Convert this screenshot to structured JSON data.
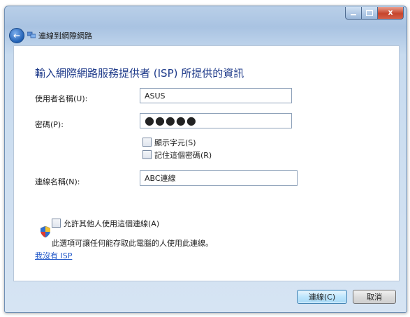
{
  "window": {
    "close_glyph": "x"
  },
  "nav": {
    "back_glyph": "←",
    "title": "連線到網際網路"
  },
  "form": {
    "heading": "輸入網際網路服務提供者 (ISP) 所提供的資訊",
    "username_label": "使用者名稱(U):",
    "username_value": "ASUS",
    "password_label": "密碼(P):",
    "password_value": "●●●●●",
    "show_chars_label": "顯示字元(S)",
    "show_chars_checked": false,
    "remember_label": "記住這個密碼(R)",
    "remember_checked": false,
    "conn_name_label": "連線名稱(N):",
    "conn_name_value": "ABC連線"
  },
  "sharing": {
    "allow_label": "允許其他人使用這個連線(A)",
    "allow_checked": false,
    "note": "此選項可讓任何能存取此電腦的人使用此連線。",
    "isp_link": "我沒有 ISP"
  },
  "buttons": {
    "connect": "連線(C)",
    "cancel": "取消"
  }
}
